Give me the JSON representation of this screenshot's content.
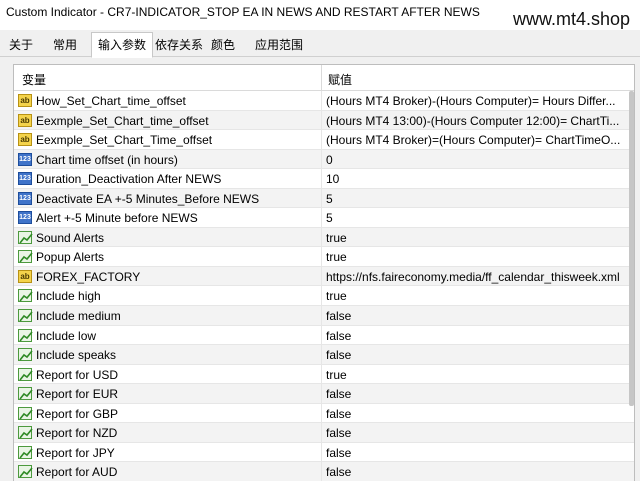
{
  "window": {
    "title": "Custom Indicator - CR7-INDICATOR_STOP EA IN NEWS AND RESTART AFTER NEWS"
  },
  "watermark": "www.mt4.shop",
  "tabs": [
    {
      "label": "关于"
    },
    {
      "label": "常用"
    },
    {
      "label": "输入参数",
      "active": true
    },
    {
      "label": "依存关系"
    },
    {
      "label": "颜色"
    },
    {
      "label": "应用范围"
    }
  ],
  "table": {
    "headers": {
      "variable": "变量",
      "value": "赋值"
    },
    "rows": [
      {
        "type": "string",
        "icon": "abc-string-icon",
        "name": "How_Set_Chart_time_offset",
        "value": "(Hours MT4 Broker)-(Hours Computer)= Hours Differ..."
      },
      {
        "type": "string",
        "icon": "abc-string-icon",
        "name": "Eexmple_Set_Chart_time_offset",
        "value": "(Hours MT4 13:00)-(Hours Computer 12:00)= ChartTi..."
      },
      {
        "type": "string",
        "icon": "abc-string-icon",
        "name": "Eexmple_Set_Chart_Time_offset",
        "value": "(Hours MT4 Broker)=(Hours Computer)= ChartTimeO..."
      },
      {
        "type": "number",
        "icon": "number-icon",
        "name": "Chart time offset (in hours)",
        "value": "0"
      },
      {
        "type": "number",
        "icon": "number-icon",
        "name": "Duration_Deactivation After NEWS",
        "value": "10"
      },
      {
        "type": "number",
        "icon": "number-icon",
        "name": "Deactivate EA +-5  Minutes_Before NEWS",
        "value": "5"
      },
      {
        "type": "number",
        "icon": "number-icon",
        "name": "Alert +-5 Minute before NEWS",
        "value": "5"
      },
      {
        "type": "bool",
        "icon": "boolean-icon",
        "name": "Sound Alerts",
        "value": "true"
      },
      {
        "type": "bool",
        "icon": "boolean-icon",
        "name": "Popup Alerts",
        "value": "true"
      },
      {
        "type": "string",
        "icon": "abc-string-icon",
        "name": "FOREX_FACTORY",
        "value": "https://nfs.faireconomy.media/ff_calendar_thisweek.xml"
      },
      {
        "type": "bool",
        "icon": "boolean-icon",
        "name": "Include high",
        "value": "true"
      },
      {
        "type": "bool",
        "icon": "boolean-icon",
        "name": "Include medium",
        "value": "false"
      },
      {
        "type": "bool",
        "icon": "boolean-icon",
        "name": "Include low",
        "value": "false"
      },
      {
        "type": "bool",
        "icon": "boolean-icon",
        "name": "Include speaks",
        "value": "false"
      },
      {
        "type": "bool",
        "icon": "boolean-icon",
        "name": "Report for USD",
        "value": "true"
      },
      {
        "type": "bool",
        "icon": "boolean-icon",
        "name": "Report for EUR",
        "value": "false"
      },
      {
        "type": "bool",
        "icon": "boolean-icon",
        "name": "Report for GBP",
        "value": "false"
      },
      {
        "type": "bool",
        "icon": "boolean-icon",
        "name": "Report for NZD",
        "value": "false"
      },
      {
        "type": "bool",
        "icon": "boolean-icon",
        "name": "Report for JPY",
        "value": "false"
      },
      {
        "type": "bool",
        "icon": "boolean-icon",
        "name": "Report for AUD",
        "value": "false"
      }
    ]
  },
  "icon_labels": {
    "string": "ab",
    "number": "123"
  },
  "colors": {
    "string_icon": "#f4d34b",
    "number_icon": "#3f73c9",
    "bool_icon": "#4d9a3e"
  }
}
